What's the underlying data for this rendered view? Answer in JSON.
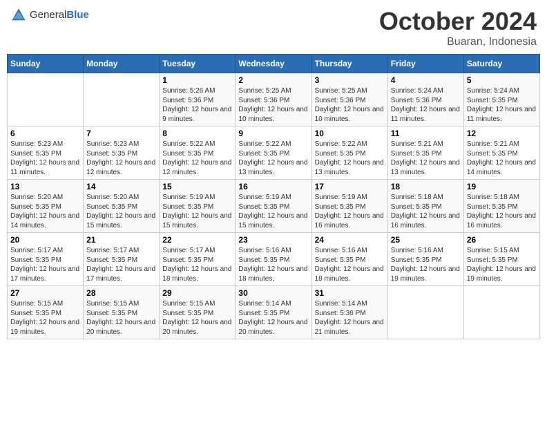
{
  "header": {
    "logo_general": "General",
    "logo_blue": "Blue",
    "month": "October 2024",
    "location": "Buaran, Indonesia"
  },
  "weekdays": [
    "Sunday",
    "Monday",
    "Tuesday",
    "Wednesday",
    "Thursday",
    "Friday",
    "Saturday"
  ],
  "weeks": [
    [
      {
        "day": "",
        "sunrise": "",
        "sunset": "",
        "daylight": ""
      },
      {
        "day": "",
        "sunrise": "",
        "sunset": "",
        "daylight": ""
      },
      {
        "day": "1",
        "sunrise": "Sunrise: 5:26 AM",
        "sunset": "Sunset: 5:36 PM",
        "daylight": "Daylight: 12 hours and 9 minutes."
      },
      {
        "day": "2",
        "sunrise": "Sunrise: 5:25 AM",
        "sunset": "Sunset: 5:36 PM",
        "daylight": "Daylight: 12 hours and 10 minutes."
      },
      {
        "day": "3",
        "sunrise": "Sunrise: 5:25 AM",
        "sunset": "Sunset: 5:36 PM",
        "daylight": "Daylight: 12 hours and 10 minutes."
      },
      {
        "day": "4",
        "sunrise": "Sunrise: 5:24 AM",
        "sunset": "Sunset: 5:36 PM",
        "daylight": "Daylight: 12 hours and 11 minutes."
      },
      {
        "day": "5",
        "sunrise": "Sunrise: 5:24 AM",
        "sunset": "Sunset: 5:35 PM",
        "daylight": "Daylight: 12 hours and 11 minutes."
      }
    ],
    [
      {
        "day": "6",
        "sunrise": "Sunrise: 5:23 AM",
        "sunset": "Sunset: 5:35 PM",
        "daylight": "Daylight: 12 hours and 11 minutes."
      },
      {
        "day": "7",
        "sunrise": "Sunrise: 5:23 AM",
        "sunset": "Sunset: 5:35 PM",
        "daylight": "Daylight: 12 hours and 12 minutes."
      },
      {
        "day": "8",
        "sunrise": "Sunrise: 5:22 AM",
        "sunset": "Sunset: 5:35 PM",
        "daylight": "Daylight: 12 hours and 12 minutes."
      },
      {
        "day": "9",
        "sunrise": "Sunrise: 5:22 AM",
        "sunset": "Sunset: 5:35 PM",
        "daylight": "Daylight: 12 hours and 13 minutes."
      },
      {
        "day": "10",
        "sunrise": "Sunrise: 5:22 AM",
        "sunset": "Sunset: 5:35 PM",
        "daylight": "Daylight: 12 hours and 13 minutes."
      },
      {
        "day": "11",
        "sunrise": "Sunrise: 5:21 AM",
        "sunset": "Sunset: 5:35 PM",
        "daylight": "Daylight: 12 hours and 13 minutes."
      },
      {
        "day": "12",
        "sunrise": "Sunrise: 5:21 AM",
        "sunset": "Sunset: 5:35 PM",
        "daylight": "Daylight: 12 hours and 14 minutes."
      }
    ],
    [
      {
        "day": "13",
        "sunrise": "Sunrise: 5:20 AM",
        "sunset": "Sunset: 5:35 PM",
        "daylight": "Daylight: 12 hours and 14 minutes."
      },
      {
        "day": "14",
        "sunrise": "Sunrise: 5:20 AM",
        "sunset": "Sunset: 5:35 PM",
        "daylight": "Daylight: 12 hours and 15 minutes."
      },
      {
        "day": "15",
        "sunrise": "Sunrise: 5:19 AM",
        "sunset": "Sunset: 5:35 PM",
        "daylight": "Daylight: 12 hours and 15 minutes."
      },
      {
        "day": "16",
        "sunrise": "Sunrise: 5:19 AM",
        "sunset": "Sunset: 5:35 PM",
        "daylight": "Daylight: 12 hours and 15 minutes."
      },
      {
        "day": "17",
        "sunrise": "Sunrise: 5:19 AM",
        "sunset": "Sunset: 5:35 PM",
        "daylight": "Daylight: 12 hours and 16 minutes."
      },
      {
        "day": "18",
        "sunrise": "Sunrise: 5:18 AM",
        "sunset": "Sunset: 5:35 PM",
        "daylight": "Daylight: 12 hours and 16 minutes."
      },
      {
        "day": "19",
        "sunrise": "Sunrise: 5:18 AM",
        "sunset": "Sunset: 5:35 PM",
        "daylight": "Daylight: 12 hours and 16 minutes."
      }
    ],
    [
      {
        "day": "20",
        "sunrise": "Sunrise: 5:17 AM",
        "sunset": "Sunset: 5:35 PM",
        "daylight": "Daylight: 12 hours and 17 minutes."
      },
      {
        "day": "21",
        "sunrise": "Sunrise: 5:17 AM",
        "sunset": "Sunset: 5:35 PM",
        "daylight": "Daylight: 12 hours and 17 minutes."
      },
      {
        "day": "22",
        "sunrise": "Sunrise: 5:17 AM",
        "sunset": "Sunset: 5:35 PM",
        "daylight": "Daylight: 12 hours and 18 minutes."
      },
      {
        "day": "23",
        "sunrise": "Sunrise: 5:16 AM",
        "sunset": "Sunset: 5:35 PM",
        "daylight": "Daylight: 12 hours and 18 minutes."
      },
      {
        "day": "24",
        "sunrise": "Sunrise: 5:16 AM",
        "sunset": "Sunset: 5:35 PM",
        "daylight": "Daylight: 12 hours and 18 minutes."
      },
      {
        "day": "25",
        "sunrise": "Sunrise: 5:16 AM",
        "sunset": "Sunset: 5:35 PM",
        "daylight": "Daylight: 12 hours and 19 minutes."
      },
      {
        "day": "26",
        "sunrise": "Sunrise: 5:15 AM",
        "sunset": "Sunset: 5:35 PM",
        "daylight": "Daylight: 12 hours and 19 minutes."
      }
    ],
    [
      {
        "day": "27",
        "sunrise": "Sunrise: 5:15 AM",
        "sunset": "Sunset: 5:35 PM",
        "daylight": "Daylight: 12 hours and 19 minutes."
      },
      {
        "day": "28",
        "sunrise": "Sunrise: 5:15 AM",
        "sunset": "Sunset: 5:35 PM",
        "daylight": "Daylight: 12 hours and 20 minutes."
      },
      {
        "day": "29",
        "sunrise": "Sunrise: 5:15 AM",
        "sunset": "Sunset: 5:35 PM",
        "daylight": "Daylight: 12 hours and 20 minutes."
      },
      {
        "day": "30",
        "sunrise": "Sunrise: 5:14 AM",
        "sunset": "Sunset: 5:35 PM",
        "daylight": "Daylight: 12 hours and 20 minutes."
      },
      {
        "day": "31",
        "sunrise": "Sunrise: 5:14 AM",
        "sunset": "Sunset: 5:36 PM",
        "daylight": "Daylight: 12 hours and 21 minutes."
      },
      {
        "day": "",
        "sunrise": "",
        "sunset": "",
        "daylight": ""
      },
      {
        "day": "",
        "sunrise": "",
        "sunset": "",
        "daylight": ""
      }
    ]
  ]
}
